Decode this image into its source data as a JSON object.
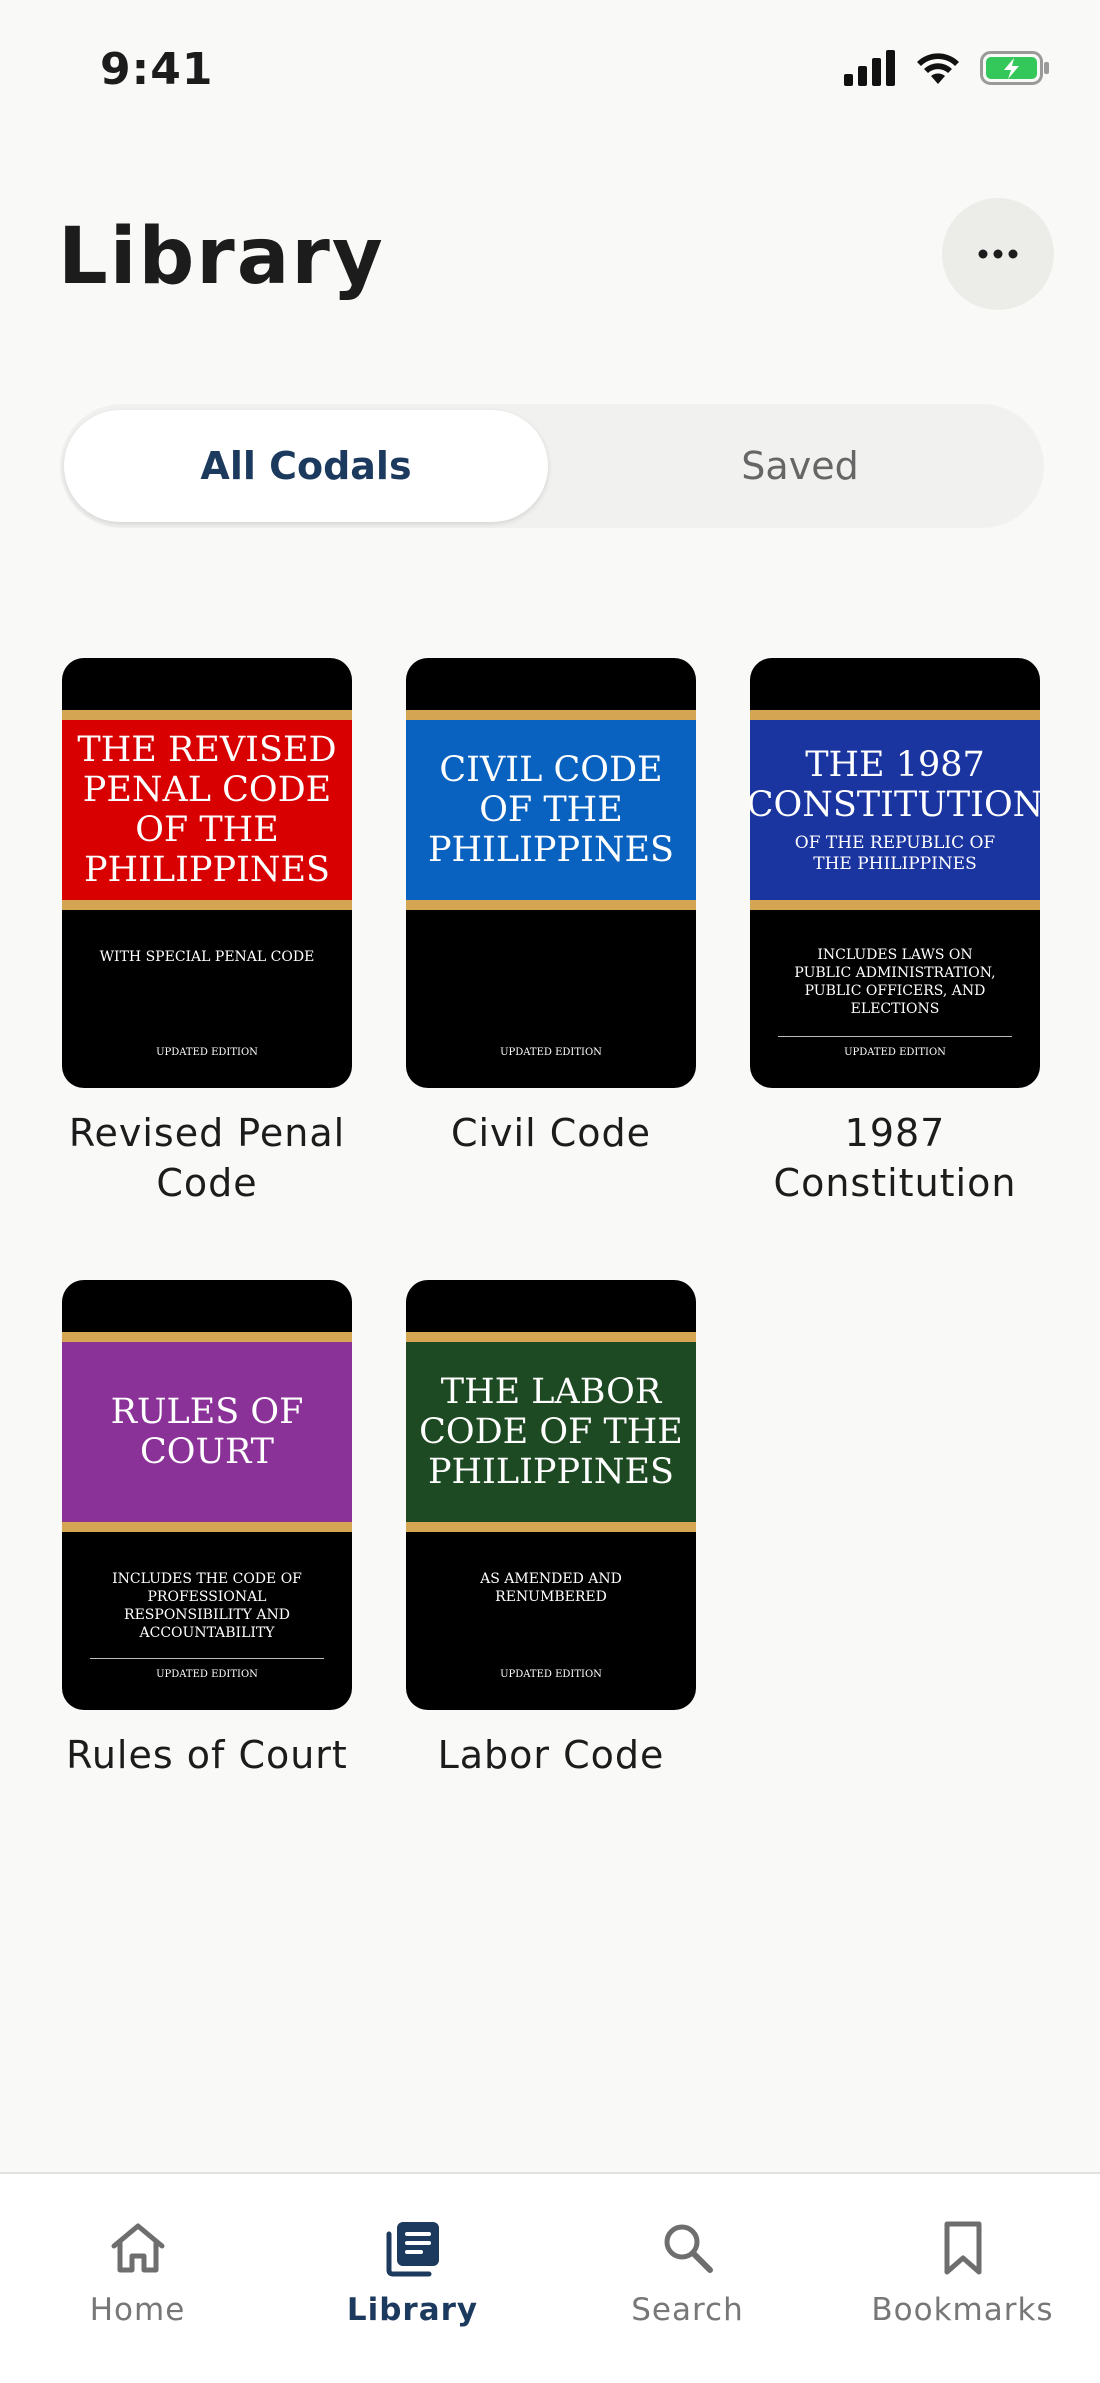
{
  "status_bar": {
    "time": "9:41"
  },
  "header": {
    "title": "Library"
  },
  "segmented": {
    "all_label": "All Codals",
    "saved_label": "Saved"
  },
  "books": [
    {
      "cover_title": "THE REVISED PENAL CODE OF THE PHILIPPINES",
      "cover_subtitle": "",
      "cover_note": "WITH SPECIAL PENAL CODE",
      "cover_edition": "UPDATED EDITION",
      "band_color": "#d80000",
      "label": "Revised Penal Code"
    },
    {
      "cover_title": "CIVIL CODE OF THE PHILIPPINES",
      "cover_subtitle": "",
      "cover_note": "",
      "cover_edition": "UPDATED EDITION",
      "band_color": "#0962bf",
      "label": "Civil Code"
    },
    {
      "cover_title": "THE 1987 CONSTITUTION",
      "cover_subtitle": "OF THE REPUBLIC OF THE PHILIPPINES",
      "cover_note": "INCLUDES LAWS ON PUBLIC ADMINISTRATION, PUBLIC OFFICERS, AND ELECTIONS",
      "cover_edition": "UPDATED EDITION",
      "band_color": "#1a34a0",
      "label": "1987 Constitution"
    },
    {
      "cover_title": "RULES OF COURT",
      "cover_subtitle": "",
      "cover_note": "INCLUDES THE CODE OF PROFESSIONAL RESPONSIBILITY AND ACCOUNTABILITY",
      "cover_edition": "UPDATED EDITION",
      "band_color": "#8b3299",
      "label": "Rules of Court"
    },
    {
      "cover_title": "THE LABOR CODE OF THE PHILIPPINES",
      "cover_subtitle": "",
      "cover_note": "AS AMENDED AND RENUMBERED",
      "cover_edition": "UPDATED EDITION",
      "band_color": "#1d4a22",
      "label": "Labor Code"
    }
  ],
  "tabs": [
    {
      "label": "Home",
      "icon": "home-icon",
      "active": false
    },
    {
      "label": "Library",
      "icon": "library-icon",
      "active": true
    },
    {
      "label": "Search",
      "icon": "search-icon",
      "active": false
    },
    {
      "label": "Bookmarks",
      "icon": "bookmark-icon",
      "active": false
    }
  ],
  "colors": {
    "accent": "#1c3a5e",
    "inactive": "#777777",
    "cover_gold": "#d4a552"
  }
}
